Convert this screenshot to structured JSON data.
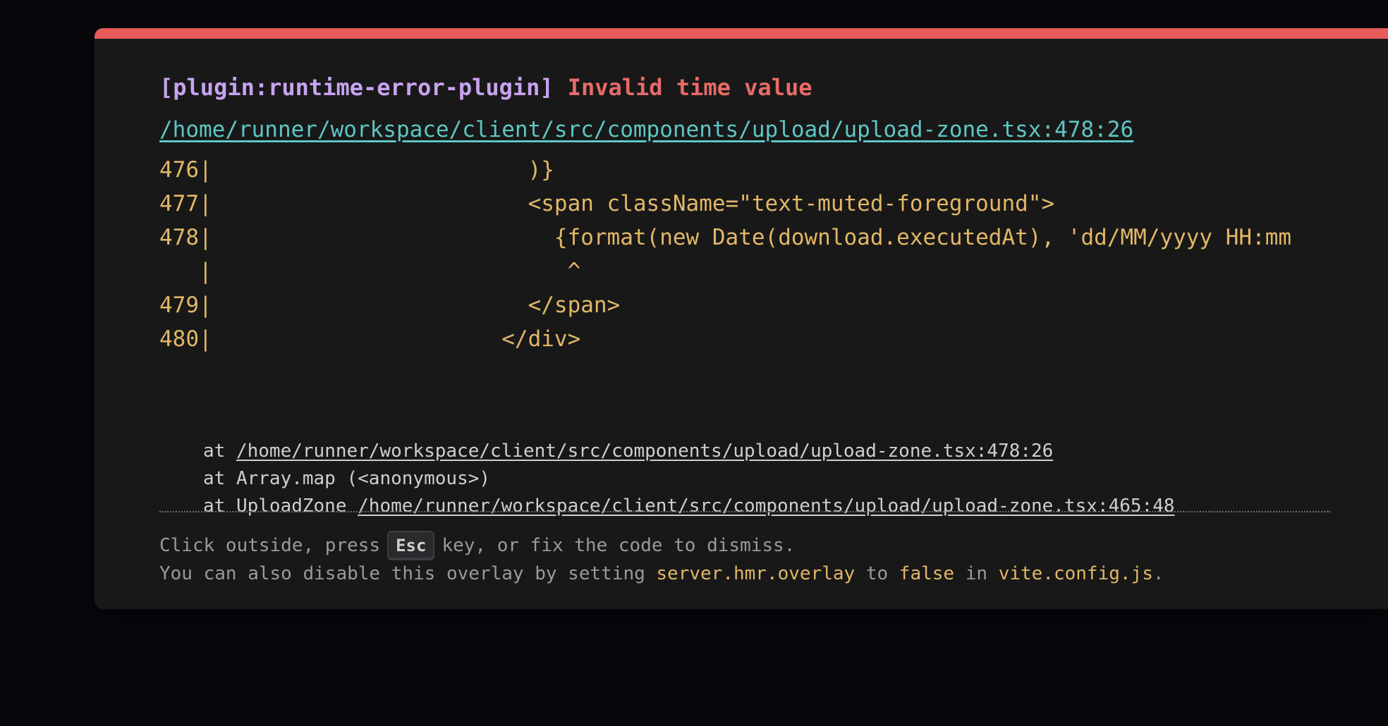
{
  "colors": {
    "accent_bar": "#e85d5a",
    "plugin": "#c7a3ef",
    "message": "#e86a67",
    "link": "#5ec6c3",
    "code": "#e2b766",
    "text": "#cfcfcf",
    "muted": "#9a9a9a",
    "panel_bg": "#181818",
    "backdrop": "#07080c"
  },
  "error": {
    "plugin": "[plugin:runtime-error-plugin]",
    "message": "Invalid time value",
    "file": "/home/runner/workspace/client/src/components/upload/upload-zone.tsx:478:26"
  },
  "frame": {
    "lines": [
      "476|                        )}",
      "477|                        <span className=\"text-muted-foreground\">",
      "478|                          {format(new Date(download.executedAt), 'dd/MM/yyyy HH:mm",
      "   |                           ^",
      "479|                        </span>",
      "480|                      </div>"
    ]
  },
  "stack": {
    "at": "at",
    "frame1_link": "/home/runner/workspace/client/src/components/upload/upload-zone.tsx:478:26",
    "frame2": "at Array.map (<anonymous>)",
    "frame3_fn": "at UploadZone",
    "frame3_link": "/home/runner/workspace/client/src/components/upload/upload-zone.tsx:465:48"
  },
  "tip": {
    "line1_a": "Click outside, press",
    "key": "Esc",
    "line1_b": "key, or fix the code to dismiss.",
    "line2_a": "You can also disable this overlay by setting",
    "setting": "server.hmr.overlay",
    "to": "to",
    "value": "false",
    "in": "in",
    "config": "vite.config.js",
    "period": "."
  }
}
